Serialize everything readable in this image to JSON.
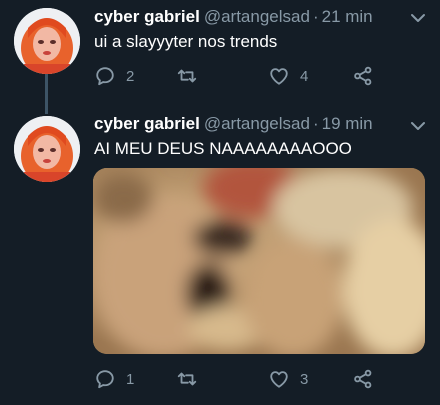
{
  "tweets": [
    {
      "name": "cyber gabriel",
      "handle": "@artangelsad",
      "separator": "·",
      "time": "21 min",
      "text": "ui a slayyyter nos trends",
      "replies": "2",
      "retweets": "",
      "likes": "4",
      "icons": [
        "reply-icon",
        "retweet-icon",
        "like-icon",
        "share-icon",
        "chevron-down-icon"
      ]
    },
    {
      "name": "cyber gabriel",
      "handle": "@artangelsad",
      "separator": "·",
      "time": "19 min",
      "text": "AI MEU DEUS NAAAAAAAAOOO",
      "replies": "1",
      "retweets": "",
      "likes": "3",
      "icons": [
        "reply-icon",
        "retweet-icon",
        "like-icon",
        "share-icon",
        "chevron-down-icon"
      ]
    }
  ],
  "colors": {
    "background": "#141d26",
    "text": "#ffffff",
    "muted": "#8899a6",
    "thread_line": "#3d5466"
  }
}
